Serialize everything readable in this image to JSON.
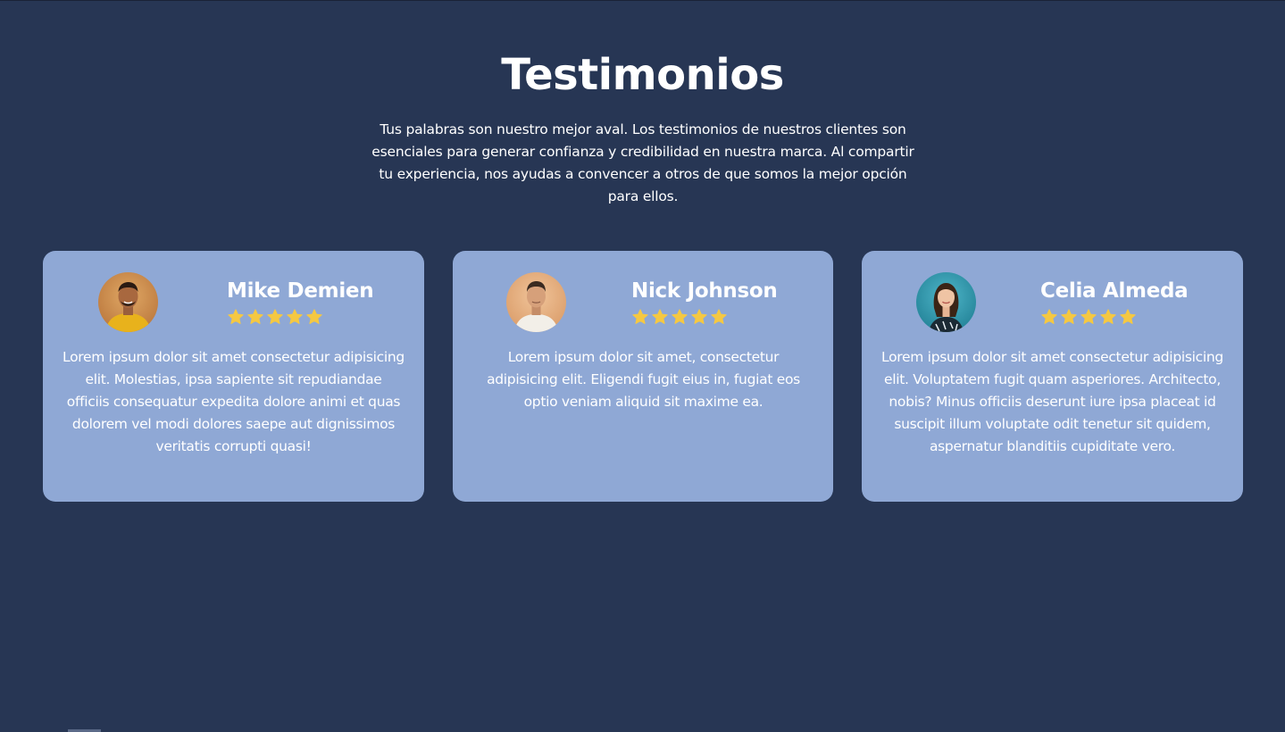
{
  "header": {
    "title": "Testimonios",
    "intro": "Tus palabras son nuestro mejor aval. Los testimonios de nuestros clientes son esenciales para generar confianza y credibilidad en nuestra marca. Al compartir tu experiencia, nos ayudas a convencer a otros de que somos la mejor opción para ellos."
  },
  "colors": {
    "background": "#273654",
    "card": "#8fa8d5",
    "star": "#f5c842",
    "text": "#ffffff"
  },
  "testimonials": [
    {
      "name": "Mike Demien",
      "rating": 5,
      "text": "Lorem ipsum dolor sit amet consectetur adipisicing elit. Molestias, ipsa sapiente sit repudiandae officiis consequatur expedita dolore animi et quas dolorem vel modi dolores saepe aut dignissimos veritatis corrupti quasi!",
      "avatar_icon": "avatar-man-yellow-shirt"
    },
    {
      "name": "Nick Johnson",
      "rating": 5,
      "text": "Lorem ipsum dolor sit amet, consectetur adipisicing elit. Eligendi fugit eius in, fugiat eos optio veniam aliquid sit maxime ea.",
      "avatar_icon": "avatar-man-white-shirt"
    },
    {
      "name": "Celia Almeda",
      "rating": 5,
      "text": "Lorem ipsum dolor sit amet consectetur adipisicing elit. Voluptatem fugit quam asperiores. Architecto, nobis? Minus officiis deserunt iure ipsa placeat id suscipit illum voluptate odit tenetur sit quidem, aspernatur blanditiis cupiditate vero.",
      "avatar_icon": "avatar-woman-teal-bg"
    }
  ]
}
